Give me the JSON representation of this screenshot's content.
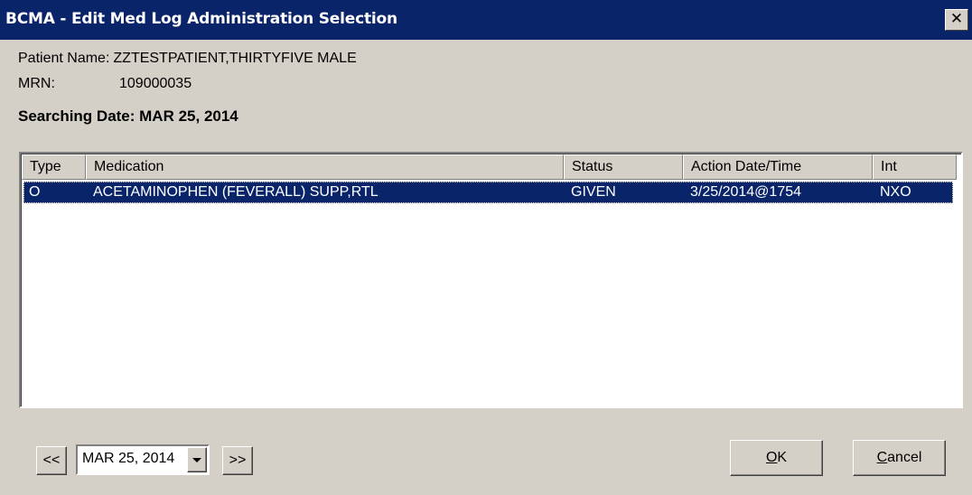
{
  "window": {
    "title": "BCMA - Edit Med Log Administration Selection",
    "close_glyph": "✕"
  },
  "patient": {
    "name_label": "Patient Name:",
    "name_value": "ZZTESTPATIENT,THIRTYFIVE MALE",
    "mrn_label": "MRN:",
    "mrn_value": "109000035"
  },
  "searching_date": "Searching Date: MAR 25, 2014",
  "table": {
    "columns": [
      "Type",
      "Medication",
      "Status",
      "Action Date/Time",
      "Int"
    ],
    "rows": [
      {
        "type": "O",
        "medication": "ACETAMINOPHEN (FEVERALL) SUPP,RTL",
        "status": "GIVEN",
        "action_datetime": "3/25/2014@1754",
        "int": "NXO",
        "selected": true
      }
    ]
  },
  "footer": {
    "prev_label": "<<",
    "date_value": "MAR 25, 2014",
    "next_label": ">>",
    "ok_hotkey": "O",
    "ok_rest": "K",
    "cancel_hotkey": "C",
    "cancel_rest": "ancel"
  },
  "colors": {
    "titlebar": "#0a246a",
    "face": "#d4d0c8",
    "selection": "#0a246a"
  }
}
